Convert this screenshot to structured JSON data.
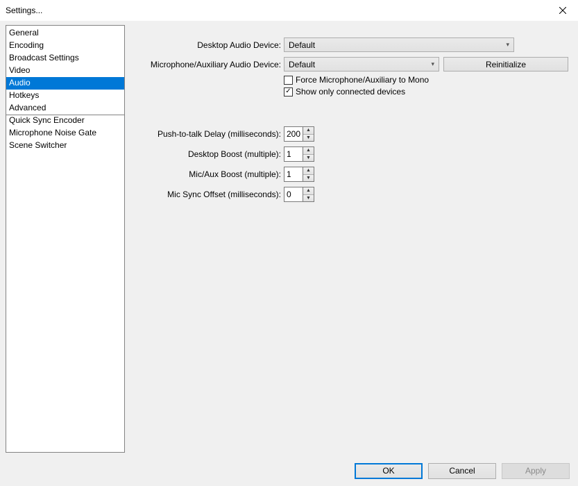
{
  "window": {
    "title": "Settings..."
  },
  "sidebar": {
    "items": [
      {
        "label": "General"
      },
      {
        "label": "Encoding"
      },
      {
        "label": "Broadcast Settings"
      },
      {
        "label": "Video"
      },
      {
        "label": "Audio"
      },
      {
        "label": "Hotkeys"
      },
      {
        "label": "Advanced"
      },
      {
        "label": "Quick Sync Encoder"
      },
      {
        "label": "Microphone Noise Gate"
      },
      {
        "label": "Scene Switcher"
      }
    ],
    "selected_index": 4,
    "separator_before_index": 7
  },
  "main": {
    "desktop_audio": {
      "label": "Desktop Audio Device:",
      "value": "Default"
    },
    "mic_audio": {
      "label": "Microphone/Auxiliary Audio Device:",
      "value": "Default"
    },
    "reinitialize_label": "Reinitialize",
    "force_mono": {
      "label": "Force Microphone/Auxiliary to Mono",
      "checked": false
    },
    "show_connected": {
      "label": "Show only connected devices",
      "checked": true
    },
    "ptt_delay": {
      "label": "Push-to-talk Delay (milliseconds):",
      "value": "200"
    },
    "desktop_boost": {
      "label": "Desktop Boost (multiple):",
      "value": "1"
    },
    "mic_boost": {
      "label": "Mic/Aux Boost (multiple):",
      "value": "1"
    },
    "mic_sync": {
      "label": "Mic Sync Offset (milliseconds):",
      "value": "0"
    }
  },
  "buttons": {
    "ok": "OK",
    "cancel": "Cancel",
    "apply": "Apply"
  },
  "check_glyph": "✓"
}
